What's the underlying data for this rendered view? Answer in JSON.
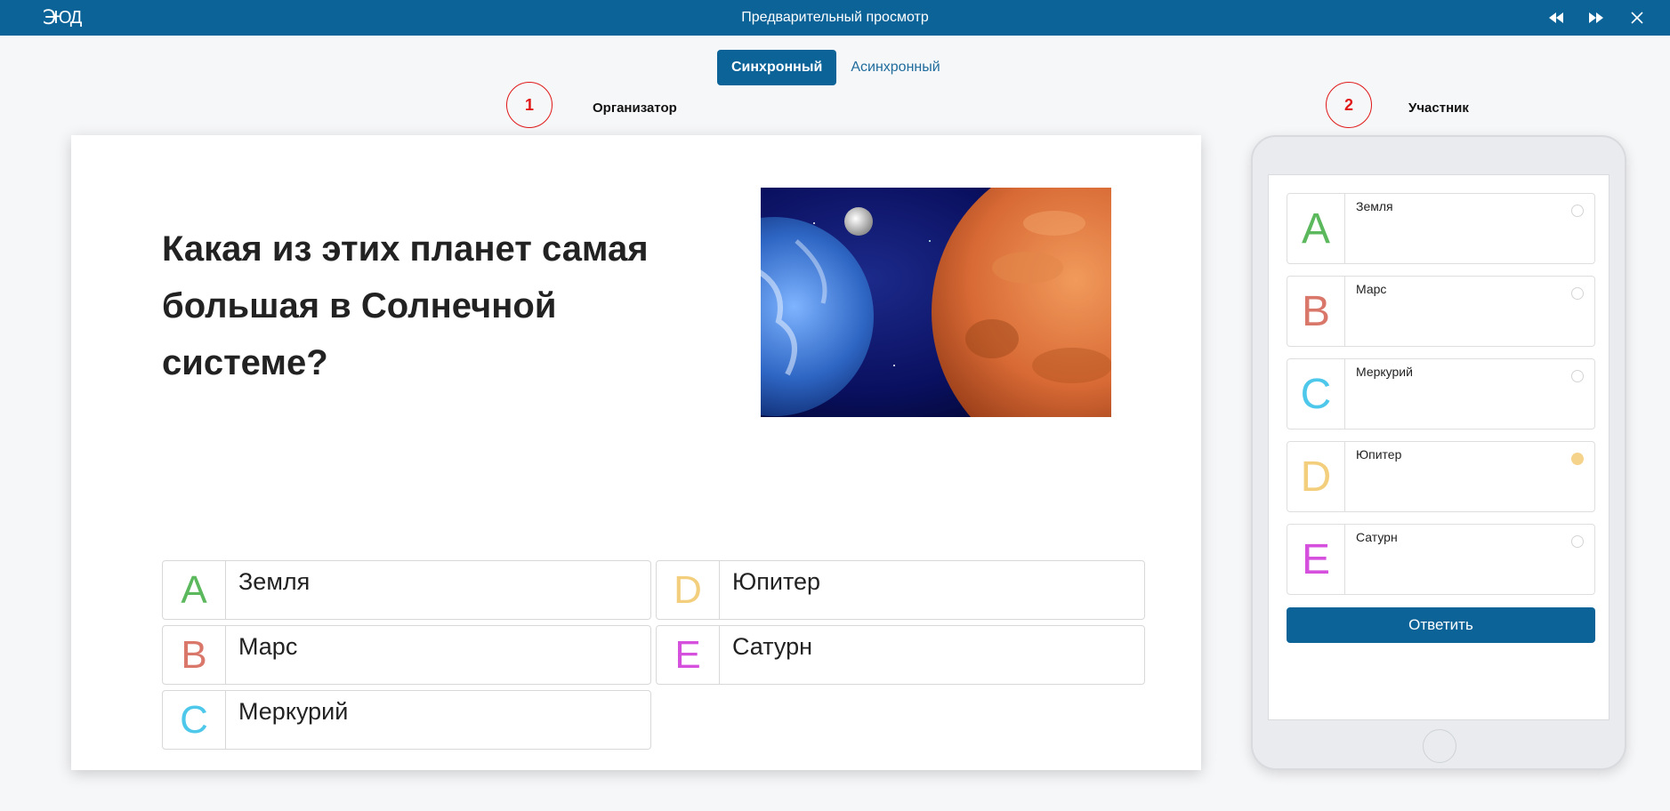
{
  "app": {
    "logo_text": "ЮД",
    "title": "Предварительный просмотр"
  },
  "mode": {
    "sync_label": "Синхронный",
    "async_label": "Асинхронный",
    "selected": "sync"
  },
  "sections": {
    "organizer": {
      "marker": "1",
      "label": "Организатор"
    },
    "participant": {
      "marker": "2",
      "label": "Участник"
    }
  },
  "slide": {
    "question": "Какая из этих планет самая большая в Солнечной системе?",
    "answers": [
      {
        "letter": "A",
        "text": "Земля",
        "color": "#5cb85c"
      },
      {
        "letter": "B",
        "text": "Марс",
        "color": "#d9776a"
      },
      {
        "letter": "C",
        "text": "Меркурий",
        "color": "#4ec8ea"
      },
      {
        "letter": "D",
        "text": "Юпитер",
        "color": "#f3cf7d"
      },
      {
        "letter": "E",
        "text": "Сатурн",
        "color": "#d550dd"
      }
    ]
  },
  "participant": {
    "answers": [
      {
        "letter": "A",
        "text": "Земля",
        "color": "#5cb85c",
        "selected": false
      },
      {
        "letter": "B",
        "text": "Марс",
        "color": "#d9776a",
        "selected": false
      },
      {
        "letter": "C",
        "text": "Меркурий",
        "color": "#4ec8ea",
        "selected": false
      },
      {
        "letter": "D",
        "text": "Юпитер",
        "color": "#f3cf7d",
        "selected": true
      },
      {
        "letter": "E",
        "text": "Сатурн",
        "color": "#d550dd",
        "selected": false
      }
    ],
    "submit_label": "Ответить"
  },
  "colors": {
    "brand": "#0b6398",
    "marker": "#e01818"
  },
  "icons": {
    "prev": "rewind-icon",
    "next": "fast-forward-icon",
    "close": "close-icon"
  }
}
